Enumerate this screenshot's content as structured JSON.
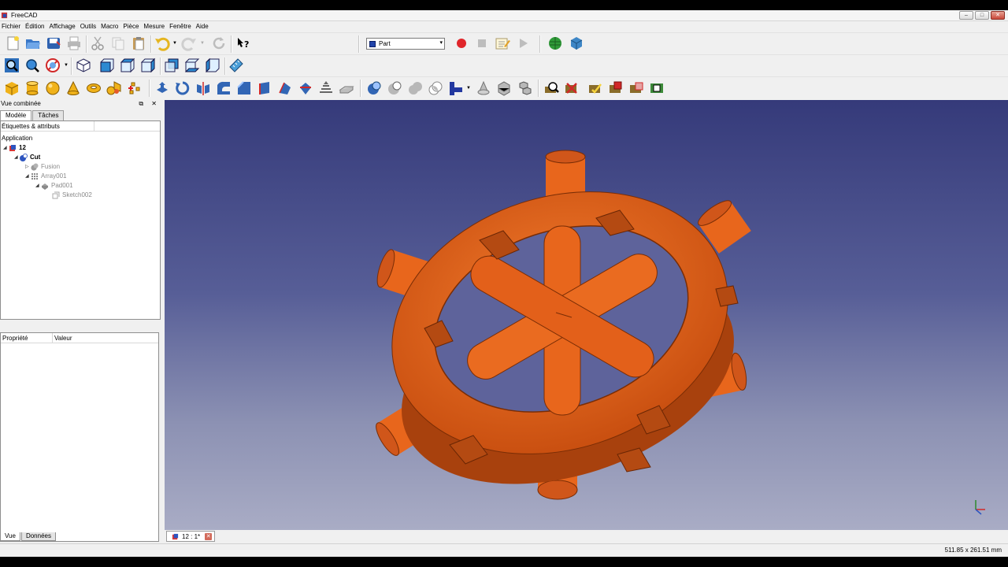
{
  "window": {
    "title": "FreeCAD",
    "minimize": "–",
    "maximize": "□",
    "close": "✕"
  },
  "menu": [
    "Fichier",
    "Édition",
    "Affichage",
    "Outils",
    "Macro",
    "Pièce",
    "Mesure",
    "Fenêtre",
    "Aide"
  ],
  "workbench": {
    "selected": "Part",
    "arrow": "▾"
  },
  "combo": {
    "title": "Vue combinée",
    "controls": "⧉ ✕",
    "tabs": [
      "Modèle",
      "Tâches"
    ],
    "tree_header": "Étiquettes & attributs",
    "tree": [
      {
        "label": "Application",
        "level": 0
      },
      {
        "label": "12",
        "level": 1
      },
      {
        "label": "Cut",
        "level": 2
      },
      {
        "label": "Fusion",
        "level": 3
      },
      {
        "label": "Array001",
        "level": 3
      },
      {
        "label": "Pad001",
        "level": 4
      },
      {
        "label": "Sketch002",
        "level": 5
      }
    ],
    "props_header": {
      "col1": "Propriété",
      "col2": "Valeur"
    },
    "bottom_tabs": [
      "Vue",
      "Données"
    ]
  },
  "doc_tab": {
    "label": "12 : 1*",
    "close": "✕"
  },
  "status": {
    "dimensions": "511.85 x 261.51 mm"
  },
  "colors": {
    "model": "#e8661c",
    "viewport_top": "#353a7a",
    "viewport_bottom": "#a9acc5"
  }
}
